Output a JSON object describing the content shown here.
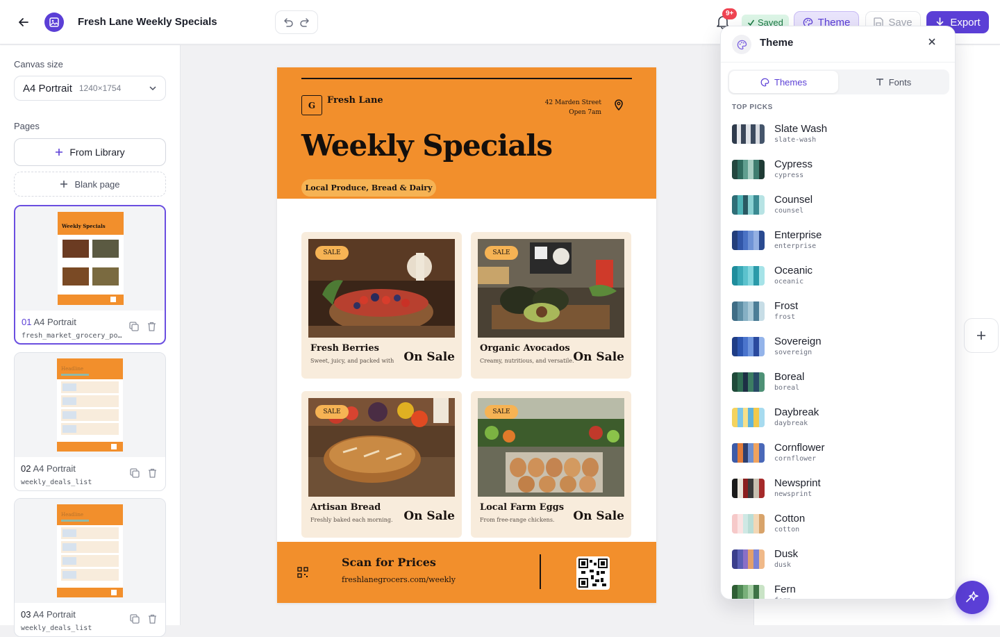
{
  "header": {
    "doc_title": "Fresh Lane Weekly Specials",
    "notif_count": "9+",
    "saved_label": "Saved",
    "theme_label": "Theme",
    "save_label": "Save",
    "export_label": "Export"
  },
  "sidebar": {
    "canvas_size_label": "Canvas size",
    "canvas_name": "A4 Portrait",
    "canvas_dims": "1240×1754",
    "pages_label": "Pages",
    "from_library": "From Library",
    "blank_page": "Blank page",
    "pages": [
      {
        "num": "01",
        "kind": "A4 Portrait",
        "file": "fresh_market_grocery_poster"
      },
      {
        "num": "02",
        "kind": "A4 Portrait",
        "file": "weekly_deals_list"
      },
      {
        "num": "03",
        "kind": "A4 Portrait",
        "file": "weekly_deals_list"
      }
    ]
  },
  "poster": {
    "brand": "Fresh Lane",
    "logo_letter": "G",
    "address_line1": "42 Marden Street",
    "address_line2": "Open 7am",
    "title": "Weekly Specials",
    "tagline": "Local Produce, Bread & Dairy",
    "sale_badge": "SALE",
    "price_label": "On Sale",
    "products": [
      {
        "name": "Fresh Berries",
        "desc": "Sweet, juicy, and packed with"
      },
      {
        "name": "Organic Avocados",
        "desc": "Creamy, nutritious, and versatile."
      },
      {
        "name": "Artisan Bread",
        "desc": "Freshly baked each morning."
      },
      {
        "name": "Local Farm Eggs",
        "desc": "From free-range chickens."
      }
    ],
    "footer_title": "Scan for Prices",
    "footer_url": "freshlanegrocers.com/weekly"
  },
  "thumbs": {
    "title1": "Weekly Specials",
    "title2": "Headline",
    "title3": "Headline"
  },
  "theme_panel": {
    "title": "Theme",
    "tab_themes": "Themes",
    "tab_fonts": "Fonts",
    "section": "TOP PICKS",
    "themes": [
      {
        "name": "Slate Wash",
        "slug": "slate-wash",
        "colors": [
          "#2f3b4c",
          "#e6e8ec",
          "#3a4658",
          "#dfe2e7",
          "#3c4a5e",
          "#d8dbe1",
          "#45556b"
        ]
      },
      {
        "name": "Cypress",
        "slug": "cypress",
        "colors": [
          "#24473f",
          "#2f6b5e",
          "#5f9e8f",
          "#a9cfc4",
          "#3f7d70",
          "#1f3b35"
        ]
      },
      {
        "name": "Counsel",
        "slug": "counsel",
        "colors": [
          "#2f6e77",
          "#4fb3b7",
          "#2a5963",
          "#8bd1d3",
          "#3b8a92",
          "#b7e3e4"
        ]
      },
      {
        "name": "Enterprise",
        "slug": "enterprise",
        "colors": [
          "#233e7a",
          "#3156a8",
          "#4a72c4",
          "#6f93d6",
          "#94b0e2",
          "#2a4a90"
        ]
      },
      {
        "name": "Oceanic",
        "slug": "oceanic",
        "colors": [
          "#1f8d9c",
          "#3aa9b7",
          "#5cc2cd",
          "#82d6de",
          "#2b9aa9",
          "#a6e3e8"
        ]
      },
      {
        "name": "Frost",
        "slug": "frost",
        "colors": [
          "#3f6d86",
          "#5e8fa6",
          "#86b0c4",
          "#a9c9d7",
          "#4c7d96",
          "#c7dde6"
        ]
      },
      {
        "name": "Sovereign",
        "slug": "sovereign",
        "colors": [
          "#1f3d86",
          "#2c55b0",
          "#4a74cc",
          "#6f96de",
          "#2a4a9e",
          "#94b4ea"
        ]
      },
      {
        "name": "Boreal",
        "slug": "boreal",
        "colors": [
          "#1f4a3a",
          "#2e6b52",
          "#1d2f45",
          "#3c7d63",
          "#284a66",
          "#4e9176"
        ]
      },
      {
        "name": "Daybreak",
        "slug": "daybreak",
        "colors": [
          "#f4d35e",
          "#7cc6e8",
          "#f7e08a",
          "#5fb3dc",
          "#f2c94c",
          "#a7dbef"
        ]
      },
      {
        "name": "Cornflower",
        "slug": "cornflower",
        "colors": [
          "#3d5ba8",
          "#e07b39",
          "#2e3f6e",
          "#6f8fd0",
          "#f0a35e",
          "#4a68b8"
        ]
      },
      {
        "name": "Newsprint",
        "slug": "newsprint",
        "colors": [
          "#1a1a1a",
          "#e9e4da",
          "#8b1e1e",
          "#3a3a3a",
          "#c7bfb0",
          "#a52a2a"
        ]
      },
      {
        "name": "Cotton",
        "slug": "cotton",
        "colors": [
          "#f6c9c9",
          "#fbe3e3",
          "#cfe8e4",
          "#b9ddd6",
          "#f2d7b6",
          "#d8a36a"
        ]
      },
      {
        "name": "Dusk",
        "slug": "dusk",
        "colors": [
          "#3b3f8c",
          "#5a5fb5",
          "#8a6fc6",
          "#e3a06a",
          "#7b82d4",
          "#f0b989"
        ]
      },
      {
        "name": "Fern",
        "slug": "fern",
        "colors": [
          "#2f5e35",
          "#4f8a55",
          "#79b07a",
          "#a8d0a6",
          "#3e7346",
          "#c9e3c6"
        ]
      }
    ]
  }
}
